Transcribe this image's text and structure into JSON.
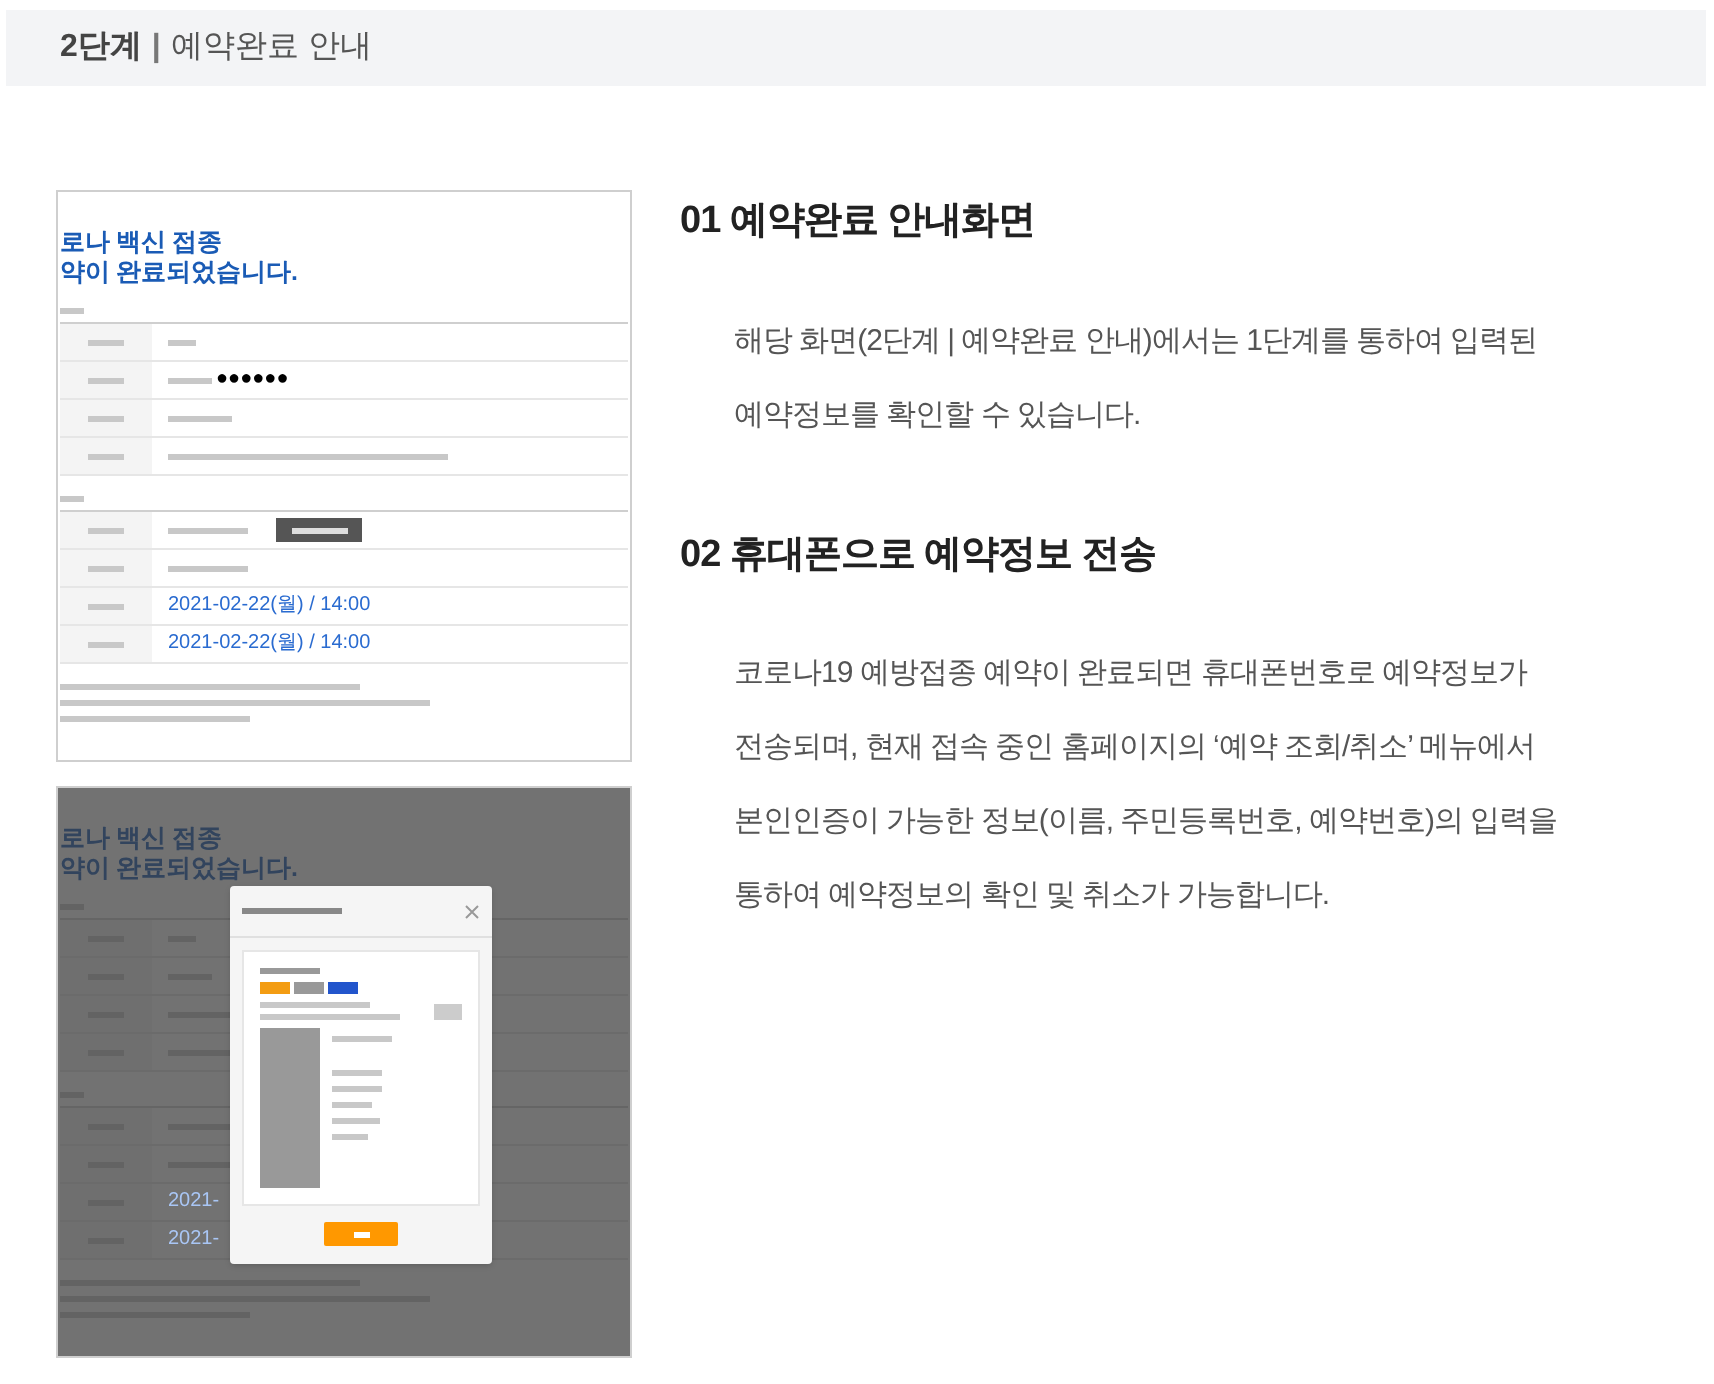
{
  "header": {
    "step": "2단계",
    "separator": "|",
    "title": "예약완료 안내"
  },
  "screenshots": [
    {
      "kind": "page",
      "headline": [
        "로나 백신 접종",
        "약이 완료되었습니다."
      ],
      "masked": "●●●●●●",
      "dates": [
        "2021-02-22(월) / 14:00",
        "2021-02-22(월) / 14:00"
      ]
    },
    {
      "kind": "modal",
      "headline": [
        "로나 백신 접종",
        "약이 완료되었습니다."
      ],
      "dates": [
        "2021-",
        "2021-"
      ]
    }
  ],
  "sections": [
    {
      "number": "01",
      "title": "예약완료 안내화면",
      "lines": [
        "해당 화면(2단계 | 예약완료 안내)에서는 1단계를 통하여 입력된",
        "예약정보를 확인할 수 있습니다."
      ]
    },
    {
      "number": "02",
      "title": "휴대폰으로 예약정보 전송",
      "lines": [
        "코로나19 예방접종 예약이 완료되면 휴대폰번호로 예약정보가",
        "전송되며, 현재 접속 중인 홈페이지의 ‘예약 조회/취소’ 메뉴에서",
        "본인인증이 가능한 정보(이름, 주민등록번호, 예약번호)의 입력을",
        "통하여 예약정보의 확인 및 취소가 가능합니다."
      ]
    }
  ]
}
